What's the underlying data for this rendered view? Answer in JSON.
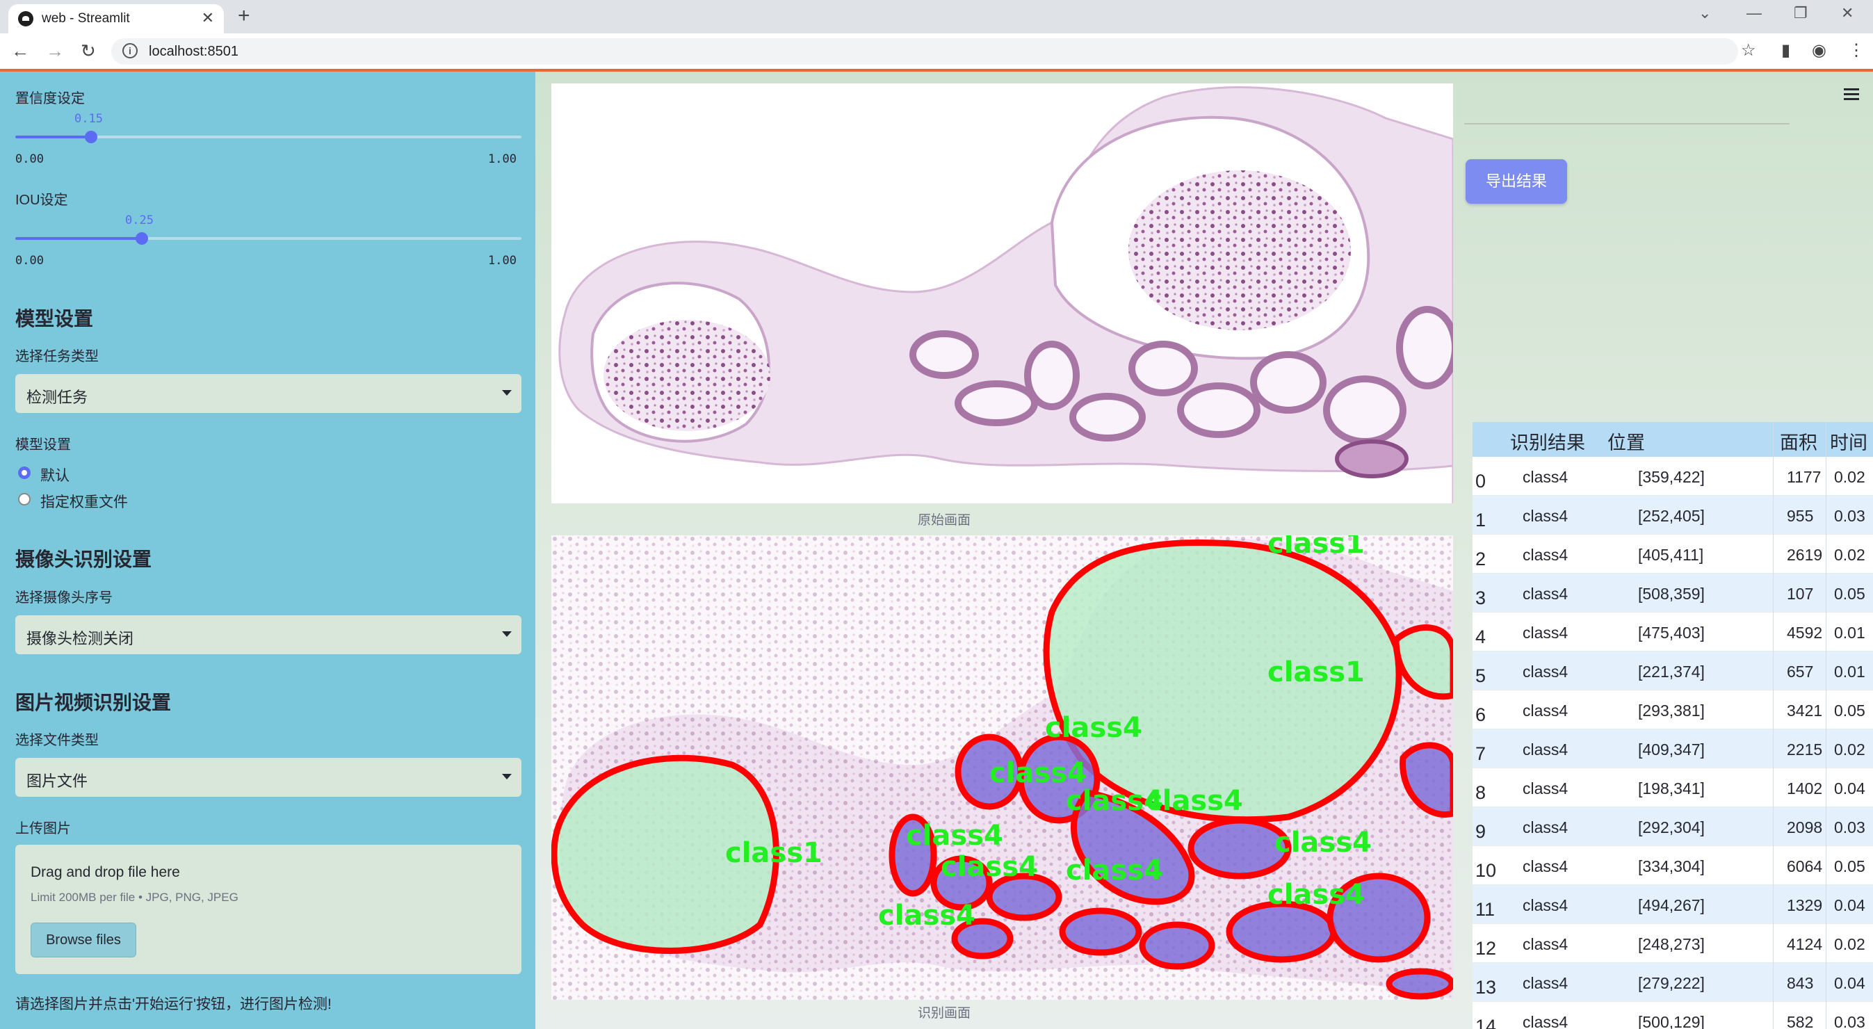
{
  "browser": {
    "tab_title": "web - Streamlit",
    "url": "localhost:8501"
  },
  "sidebar": {
    "confidence": {
      "label": "置信度设定",
      "value": "0.15",
      "value_fraction": 0.15,
      "min": "0.00",
      "max": "1.00"
    },
    "iou": {
      "label": "IOU设定",
      "value": "0.25",
      "value_fraction": 0.25,
      "min": "0.00",
      "max": "1.00"
    },
    "model_heading": "模型设置",
    "task_label": "选择任务类型",
    "task_value": "检测任务",
    "model_setting_label": "模型设置",
    "radio_default": "默认",
    "radio_custom": "指定权重文件",
    "camera_heading": "摄像头识别设置",
    "camera_label": "选择摄像头序号",
    "camera_value": "摄像头检测关闭",
    "media_heading": "图片视频识别设置",
    "filetype_label": "选择文件类型",
    "filetype_value": "图片文件",
    "upload_label": "上传图片",
    "upload_title": "Drag and drop file here",
    "upload_sub": "Limit 200MB per file • JPG, PNG, JPEG",
    "browse_label": "Browse files",
    "footer_text": "请选择图片并点击'开始运行'按钮，进行图片检测!"
  },
  "main": {
    "original_caption": "原始画面",
    "result_caption": "识别画面",
    "export_label": "导出结果",
    "detection_labels": [
      "class1",
      "class1",
      "class1",
      "class4",
      "class4",
      "class4",
      "class4",
      "class4",
      "class4",
      "class4",
      "class4",
      "class4",
      "class4"
    ]
  },
  "table": {
    "headers": [
      "识别结果",
      "位置",
      "面积",
      "时间"
    ],
    "rows": [
      {
        "idx": "0",
        "cls": "class4",
        "pos": "[359,422]",
        "area": "1177",
        "time": "0.02"
      },
      {
        "idx": "1",
        "cls": "class4",
        "pos": "[252,405]",
        "area": "955",
        "time": "0.03"
      },
      {
        "idx": "2",
        "cls": "class4",
        "pos": "[405,411]",
        "area": "2619",
        "time": "0.02"
      },
      {
        "idx": "3",
        "cls": "class4",
        "pos": "[508,359]",
        "area": "107",
        "time": "0.05"
      },
      {
        "idx": "4",
        "cls": "class4",
        "pos": "[475,403]",
        "area": "4592",
        "time": "0.01"
      },
      {
        "idx": "5",
        "cls": "class4",
        "pos": "[221,374]",
        "area": "657",
        "time": "0.01"
      },
      {
        "idx": "6",
        "cls": "class4",
        "pos": "[293,381]",
        "area": "3421",
        "time": "0.05"
      },
      {
        "idx": "7",
        "cls": "class4",
        "pos": "[409,347]",
        "area": "2215",
        "time": "0.02"
      },
      {
        "idx": "8",
        "cls": "class4",
        "pos": "[198,341]",
        "area": "1402",
        "time": "0.04"
      },
      {
        "idx": "9",
        "cls": "class4",
        "pos": "[292,304]",
        "area": "2098",
        "time": "0.03"
      },
      {
        "idx": "10",
        "cls": "class4",
        "pos": "[334,304]",
        "area": "6064",
        "time": "0.05"
      },
      {
        "idx": "11",
        "cls": "class4",
        "pos": "[494,267]",
        "area": "1329",
        "time": "0.04"
      },
      {
        "idx": "12",
        "cls": "class4",
        "pos": "[248,273]",
        "area": "4124",
        "time": "0.02"
      },
      {
        "idx": "13",
        "cls": "class4",
        "pos": "[279,222]",
        "area": "843",
        "time": "0.04"
      },
      {
        "idx": "14",
        "cls": "class4",
        "pos": "[500,129]",
        "area": "582",
        "time": "0.03"
      }
    ]
  },
  "colors": {
    "sidebar_bg": "#7bc7dc",
    "accent": "#5b6cf2",
    "detection_outline": "#ff0000",
    "detection_label": "#22ee22",
    "class1_fill": "#b8ecc8",
    "class4_fill": "#8070d8"
  }
}
